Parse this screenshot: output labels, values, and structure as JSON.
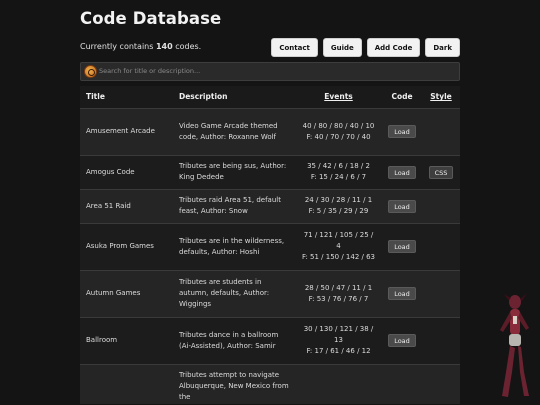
{
  "header": {
    "title": "Code Database"
  },
  "summary": {
    "prefix": "Currently contains",
    "count": "140",
    "suffix": "codes."
  },
  "nav": {
    "contact": "Contact",
    "guide": "Guide",
    "add_code": "Add Code",
    "dark": "Dark"
  },
  "search": {
    "placeholder": "Search for title or description..."
  },
  "table": {
    "headers": {
      "title": "Title",
      "description": "Description",
      "events": "Events",
      "code": "Code",
      "style": "Style"
    },
    "load_label": "Load",
    "css_label": "CSS",
    "rows": [
      {
        "title": "Amusement Arcade",
        "description": "Video Game Arcade themed code, Author: Roxanne Wolf",
        "events_line1": "40 / 80 / 80 / 40 / 10",
        "events_line2": "F: 40 / 70 / 70 / 40"
      },
      {
        "title": "Amogus Code",
        "description": "Tributes are being sus, Author: King Dedede",
        "events_line1": "35 / 42 / 6 / 18 / 2",
        "events_line2": "F: 15 / 24 / 6 / 7",
        "style": "CSS"
      },
      {
        "title": "Area 51 Raid",
        "description": "Tributes raid Area 51, default feast, Author: Snow",
        "events_line1": "24 / 30 / 28 / 11 / 1",
        "events_line2": "F: 5 / 35 / 29 / 29"
      },
      {
        "title": "Asuka Prom Games",
        "description": "Tributes are in the wilderness, defaults, Author: Hoshi",
        "events_line1": "71 / 121 / 105 / 25 / 4",
        "events_line2": "F: 51 / 150 / 142 / 63"
      },
      {
        "title": "Autumn Games",
        "description": "Tributes are students in autumn, defaults, Author: Wiggings",
        "events_line1": "28 / 50 / 47 / 11 / 1",
        "events_line2": "F: 53 / 76 / 76 / 7"
      },
      {
        "title": "Ballroom",
        "description": "Tributes dance in a ballroom (Ai-Assisted), Author: Samir",
        "events_line1": "30 / 130 / 121 / 38 / 13",
        "events_line2": "F: 17 / 61 / 46 / 12"
      },
      {
        "title": "",
        "description": "Tributes attempt to navigate Albuquerque, New Mexico from the",
        "events_line1": "",
        "events_line2": ""
      }
    ]
  }
}
